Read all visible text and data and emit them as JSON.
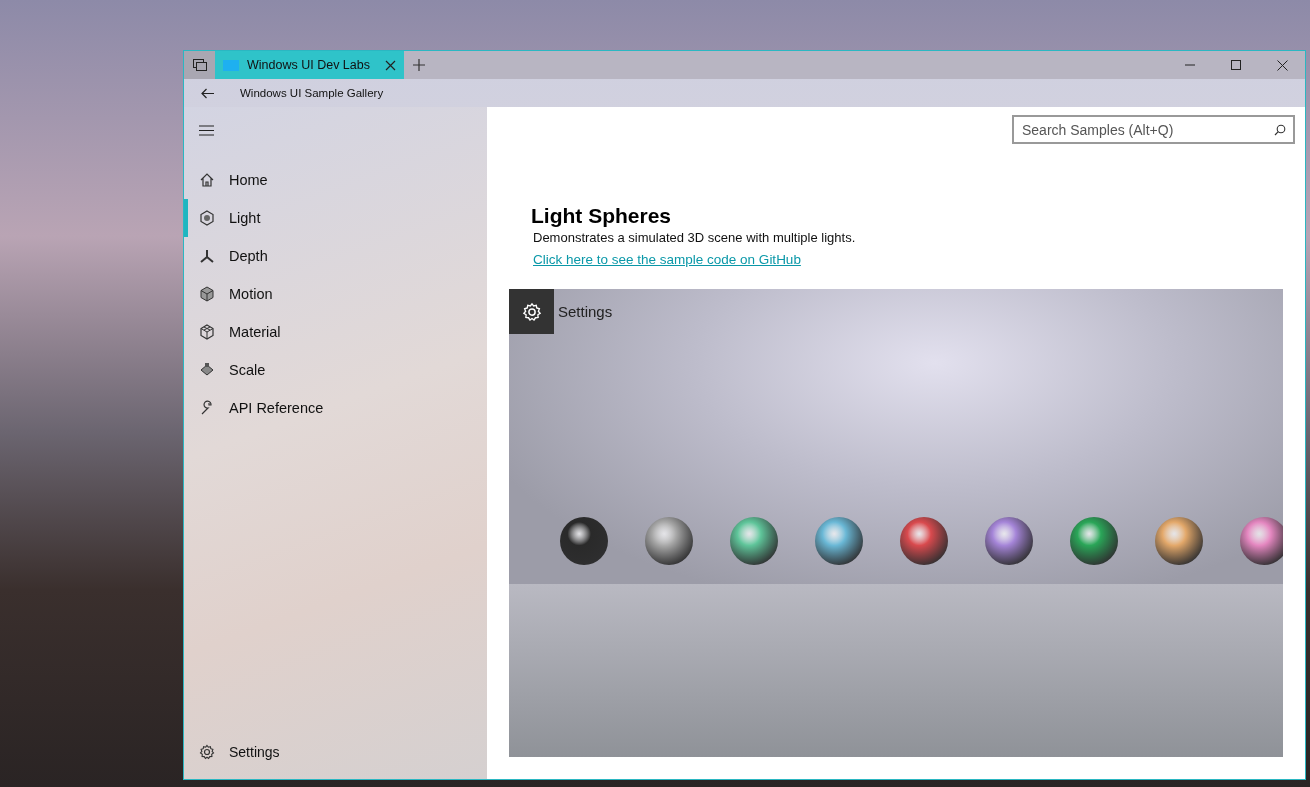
{
  "browser": {
    "tab": {
      "title": "Windows UI Dev Labs",
      "selected": true
    }
  },
  "header": {
    "title": "Windows UI Sample Gallery"
  },
  "nav": {
    "items": [
      {
        "label": "Home",
        "selected": false
      },
      {
        "label": "Light",
        "selected": true
      },
      {
        "label": "Depth",
        "selected": false
      },
      {
        "label": "Motion",
        "selected": false
      },
      {
        "label": "Material",
        "selected": false
      },
      {
        "label": "Scale",
        "selected": false
      },
      {
        "label": "API Reference",
        "selected": false
      }
    ],
    "footer": {
      "label": "Settings"
    }
  },
  "search": {
    "placeholder": "Search Samples (Alt+Q)"
  },
  "page": {
    "title": "Light Spheres",
    "description": "Demonstrates a simulated 3D scene with multiple lights.",
    "link": "Click here to see the sample code on GitHub"
  },
  "demo": {
    "settings_label": "Settings"
  }
}
